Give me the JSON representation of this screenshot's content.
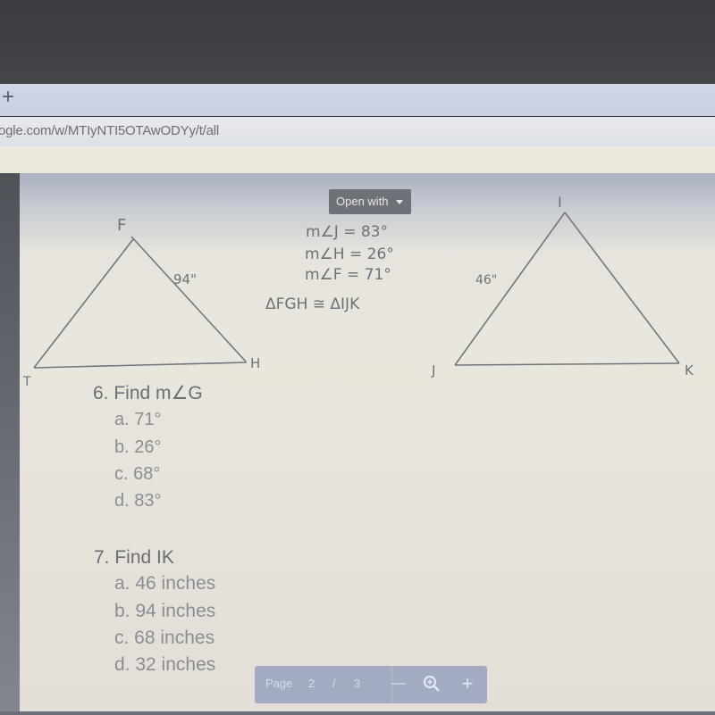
{
  "browser": {
    "new_tab_label": "+",
    "url": "ogle.com/w/MTIyNTI5OTAwODYy/t/all"
  },
  "viewer": {
    "open_with_label": "Open with",
    "pager": {
      "page_label": "Page",
      "current_page": "2",
      "separator": "/",
      "total_pages": "3",
      "zoom_out": "—",
      "zoom_in": "+"
    }
  },
  "diagram": {
    "triangle_fgh": {
      "vertices": {
        "top": "F",
        "bottom_left": "T",
        "bottom_right": "H"
      },
      "side_label": "94\""
    },
    "triangle_ijk": {
      "vertices": {
        "top": "I",
        "bottom_left": "J",
        "bottom_right": "K"
      },
      "side_label": "46\""
    },
    "given": [
      "m∠J = 83°",
      "m∠H = 26°",
      "m∠F = 71°",
      "ΔFGH ≅ ΔIJK"
    ]
  },
  "questions": [
    {
      "title": "6. Find m∠G",
      "options": [
        "a. 71°",
        "b. 26°",
        "c. 68°",
        "d. 83°"
      ]
    },
    {
      "title": "7. Find IK",
      "options": [
        "a. 46 inches",
        "b. 94 inches",
        "c. 68 inches",
        "d. 32 inches"
      ]
    }
  ]
}
